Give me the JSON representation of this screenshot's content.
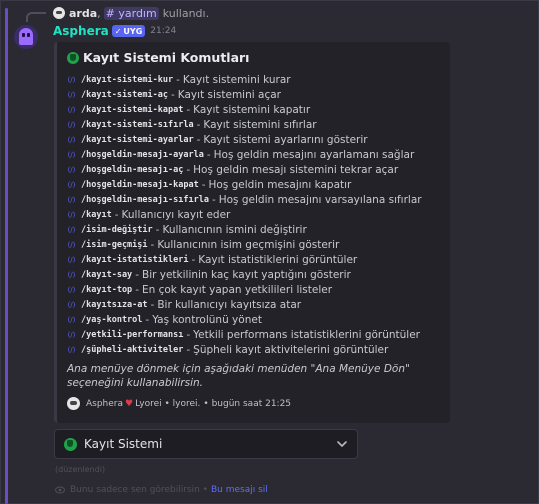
{
  "reply": {
    "username": "arda",
    "channel": "yardım",
    "separator": ",",
    "action": "kullandı."
  },
  "message": {
    "author": "Asphera",
    "badge": "UYG",
    "timestamp": "21:24"
  },
  "embed": {
    "title": "Kayıt Sistemi Komutları",
    "commands": [
      {
        "command": "/kayıt-sistemi-kur",
        "description": "Kayıt sistemini kurar"
      },
      {
        "command": "/kayıt-sistemi-aç",
        "description": "Kayıt sistemini açar"
      },
      {
        "command": "/kayıt-sistemi-kapat",
        "description": "Kayıt sistemini kapatır"
      },
      {
        "command": "/kayıt-sistemi-sıfırla",
        "description": "Kayıt sistemini sıfırlar"
      },
      {
        "command": "/kayıt-sistemi-ayarlar",
        "description": "Kayıt sistemi ayarlarını gösterir"
      },
      {
        "command": "/hoşgeldin-mesajı-ayarla",
        "description": "Hoş geldin mesajını ayarlamanı sağlar"
      },
      {
        "command": "/hoşgeldin-mesajı-aç",
        "description": "Hoş geldin mesajı sistemini tekrar açar"
      },
      {
        "command": "/hoşgeldin-mesajı-kapat",
        "description": "Hoş geldin mesajını kapatır"
      },
      {
        "command": "/hoşgeldin-mesajı-sıfırla",
        "description": "Hoş geldin mesajını varsayılana sıfırlar"
      },
      {
        "command": "/kayıt",
        "description": "Kullanıcıyı kayıt eder"
      },
      {
        "command": "/isim-değiştir",
        "description": "Kullanıcının ismini değiştirir"
      },
      {
        "command": "/isim-geçmişi",
        "description": "Kullanıcının isim geçmişini gösterir"
      },
      {
        "command": "/kayıt-istatistikleri",
        "description": "Kayıt istatistiklerini görüntüler"
      },
      {
        "command": "/kayıt-say",
        "description": "Bir yetkilinin kaç kayıt yaptığını gösterir"
      },
      {
        "command": "/kayıt-top",
        "description": "En çok kayıt yapan yetkilileri listeler"
      },
      {
        "command": "/kayıtsıza-at",
        "description": "Bir kullanıcıyı kayıtsıza atar"
      },
      {
        "command": "/yaş-kontrol",
        "description": "Yaş kontrolünü yönet"
      },
      {
        "command": "/yetkili-performansı",
        "description": "Yetkili performans istatistiklerini görüntüler"
      },
      {
        "command": "/şüpheli-aktiviteler",
        "description": "Şüpheli kayıt aktivitelerini görüntüler"
      }
    ],
    "dash": "-",
    "note": "Ana menüye dönmek için aşağıdaki menüden \"Ana Menüye Dön\" seçeneğini kullanabilirsin.",
    "footer": {
      "name_before": "Asphera",
      "name_after": "Lyorei • lyorei.",
      "time": "• bugün saat 21:25"
    }
  },
  "select": {
    "value": "Kayıt Sistemi"
  },
  "edited": "(düzenlendi)",
  "ephemeral": {
    "text": "Bunu sadece sen görebilirsin •",
    "dismiss": "Bu mesajı sil"
  },
  "colors": {
    "author": "#1fe4c4",
    "badge": "#5865f2",
    "highlight": "#6a4ec4",
    "link": "#5d6df5"
  },
  "icons": {
    "reply_avatar": "user-avatar-icon",
    "channel": "hashtag-icon",
    "embed_title": "shield-icon",
    "command": "slash-command-icon",
    "select": "shield-icon",
    "chevron": "chevron-down-icon",
    "ephemeral": "eye-icon",
    "heart": "heart-icon"
  }
}
